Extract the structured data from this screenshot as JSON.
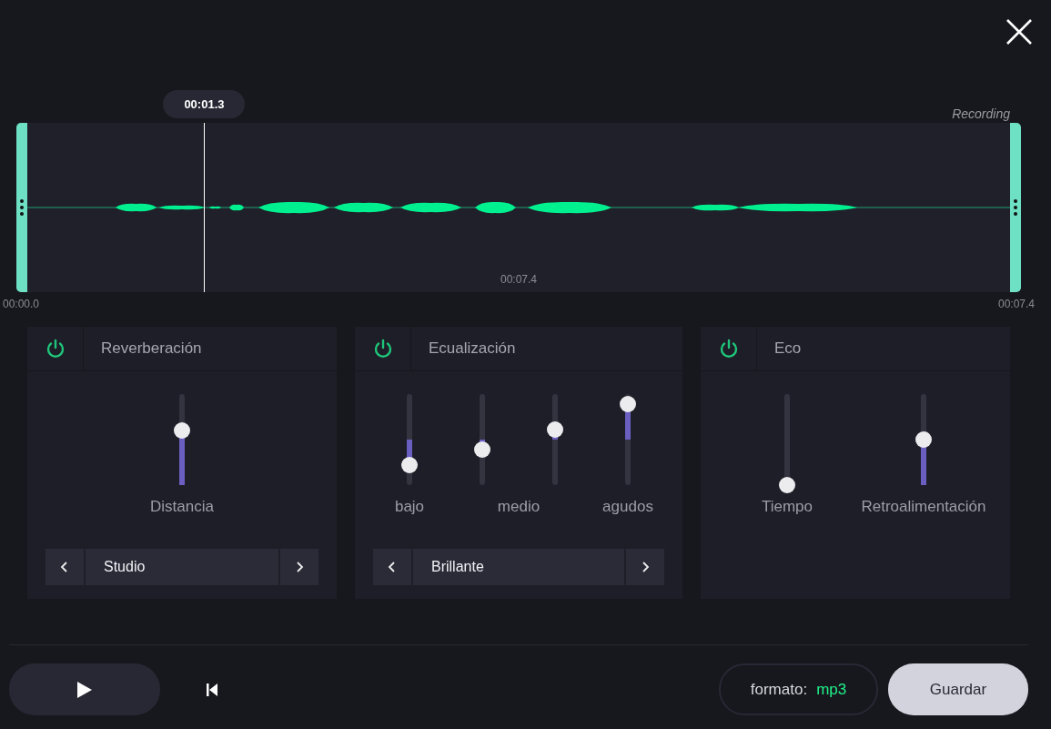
{
  "timeline": {
    "playhead_time": "00:01.3",
    "playhead": {
      "level": 0.187
    },
    "label": "Recording",
    "center_time": "00:07.4",
    "start_time": "00:00.0",
    "end_time": "00:07.4"
  },
  "effects": [
    {
      "title": "Reverberación",
      "on": true,
      "sliders": [
        {
          "kind": "unipolar",
          "level": 0.6
        }
      ],
      "labels": [
        "Distancia"
      ],
      "preset": "Studio"
    },
    {
      "title": "Ecualización",
      "on": true,
      "sliders": [
        {
          "kind": "bipolar",
          "level": 0.22
        },
        {
          "kind": "bipolar",
          "level": 0.39
        },
        {
          "kind": "bipolar",
          "level": 0.61
        },
        {
          "kind": "bipolar",
          "level": 0.89
        }
      ],
      "labels": [
        "bajo",
        "medio",
        "agudos"
      ],
      "preset": "Brillante"
    },
    {
      "title": "Eco",
      "on": true,
      "sliders": [
        {
          "kind": "unipolar",
          "level": 0.0
        },
        {
          "kind": "unipolar",
          "level": 0.5
        }
      ],
      "labels": [
        "Tiempo",
        "Retroalimentación"
      ]
    }
  ],
  "footer": {
    "format_label": "formato:",
    "format_value": "mp3",
    "save_button": "Guardar"
  }
}
